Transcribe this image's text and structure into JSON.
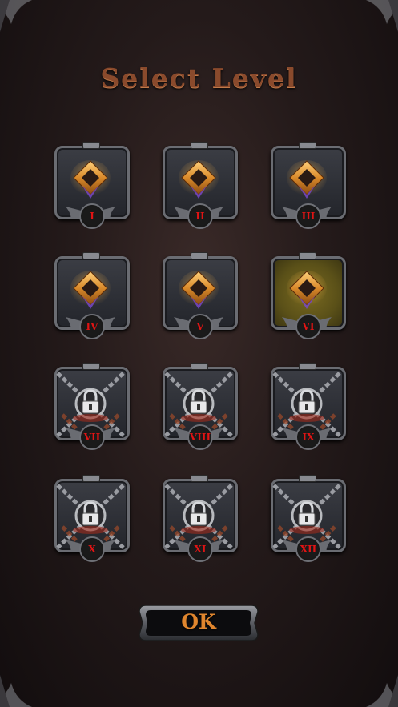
{
  "title": "Select Level",
  "ok_button": {
    "label": "OK"
  },
  "levels": [
    {
      "label": "I",
      "state": "unlocked"
    },
    {
      "label": "II",
      "state": "unlocked"
    },
    {
      "label": "III",
      "state": "unlocked"
    },
    {
      "label": "IV",
      "state": "unlocked"
    },
    {
      "label": "V",
      "state": "unlocked"
    },
    {
      "label": "VI",
      "state": "selected"
    },
    {
      "label": "VII",
      "state": "locked"
    },
    {
      "label": "VIII",
      "state": "locked"
    },
    {
      "label": "IX",
      "state": "locked"
    },
    {
      "label": "X",
      "state": "locked"
    },
    {
      "label": "XI",
      "state": "locked"
    },
    {
      "label": "XII",
      "state": "locked"
    }
  ],
  "icons": {
    "unlocked": "gem-icon",
    "locked": "chained-lock-icon",
    "frame": "ornate-corner-icon"
  },
  "colors": {
    "title": "#8a4a2c",
    "badge_text": "#e01414",
    "ok_text": "#e0862e",
    "selected_glow": "#7a6a20"
  }
}
